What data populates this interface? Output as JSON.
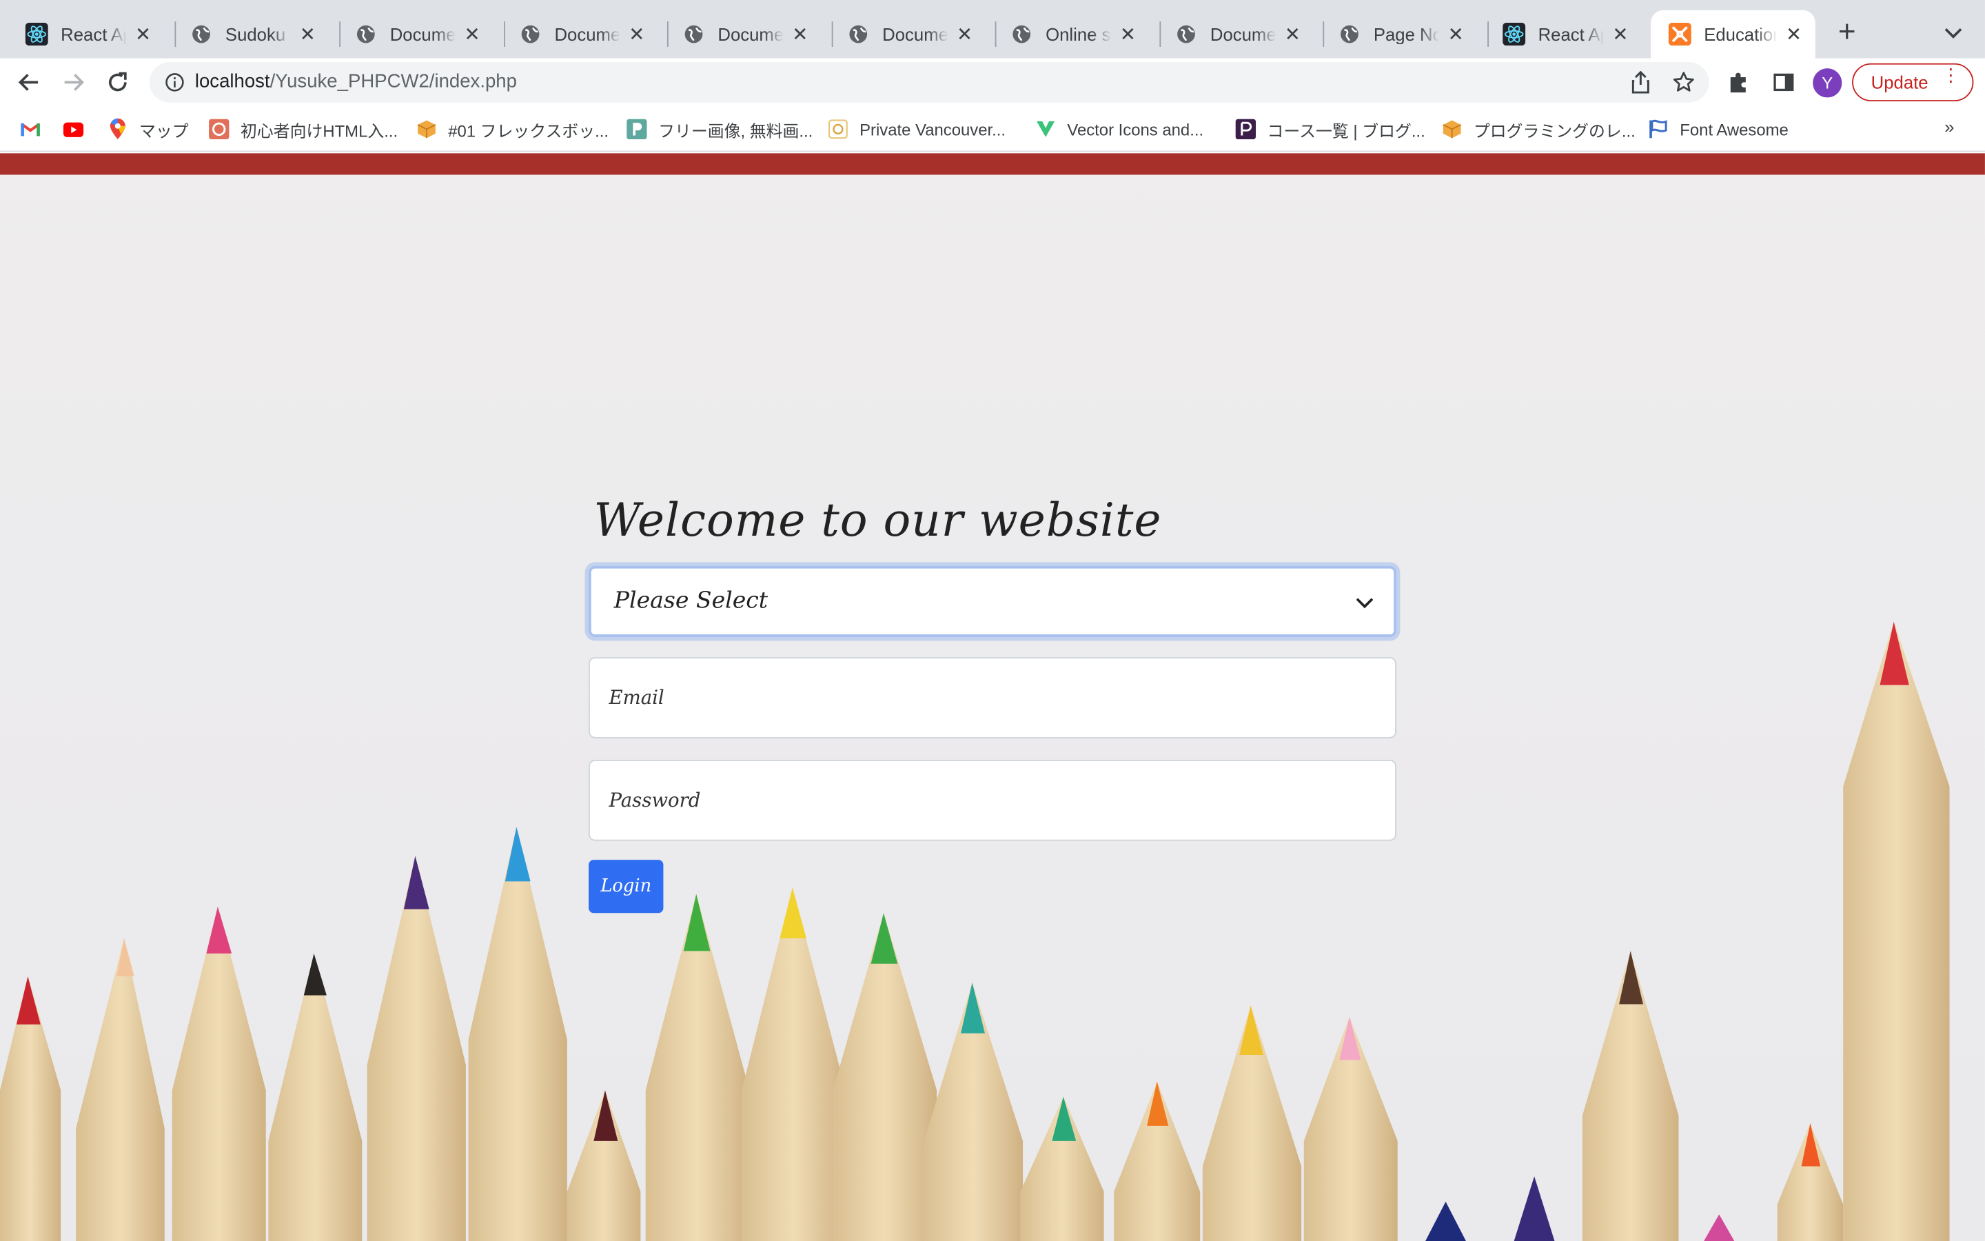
{
  "tabs": [
    {
      "title": "React App",
      "icon": "react-icon"
    },
    {
      "title": "Sudoku",
      "icon": "globe-icon"
    },
    {
      "title": "Document",
      "icon": "globe-icon"
    },
    {
      "title": "Document",
      "icon": "globe-icon"
    },
    {
      "title": "Document",
      "icon": "globe-icon"
    },
    {
      "title": "Document",
      "icon": "globe-icon"
    },
    {
      "title": "Online sTo",
      "icon": "globe-icon"
    },
    {
      "title": "Document",
      "icon": "globe-icon"
    },
    {
      "title": "Page Not",
      "icon": "globe-icon"
    },
    {
      "title": "React App",
      "icon": "react-icon"
    },
    {
      "title": "Education",
      "icon": "xampp-icon",
      "active": true
    }
  ],
  "address_bar": {
    "host": "localhost",
    "path": "/Yusuke_PHPCW2/index.php"
  },
  "profile": {
    "initial": "Y"
  },
  "update_button": {
    "label": "Update"
  },
  "bookmarks": [
    {
      "label": "",
      "icon": "gmail-icon"
    },
    {
      "label": "",
      "icon": "youtube-icon"
    },
    {
      "label": "マップ",
      "icon": "maps-icon"
    },
    {
      "label": "初心者向けHTML入...",
      "icon": "html-icon"
    },
    {
      "label": "#01 フレックスボッ...",
      "icon": "box-icon"
    },
    {
      "label": "フリー画像, 無料画...",
      "icon": "photo-icon"
    },
    {
      "label": "Private Vancouver...",
      "icon": "school-icon"
    },
    {
      "label": "Vector Icons and...",
      "icon": "vector-icon"
    },
    {
      "label": "コース一覧 | ブログ...",
      "icon": "course-icon"
    },
    {
      "label": "プログラミングのレ...",
      "icon": "box-icon"
    },
    {
      "label": "Font Awesome",
      "icon": "flag-icon"
    }
  ],
  "bookmarks_more": "»",
  "page": {
    "heading": "Welcome to our website",
    "select_value": "Please Select",
    "email_placeholder": "Email",
    "password_placeholder": "Password",
    "login_label": "Login"
  },
  "colors": {
    "top_bar": "#a8302a",
    "login_button": "#2f6df2",
    "tab_strip": "#dee1e6"
  }
}
